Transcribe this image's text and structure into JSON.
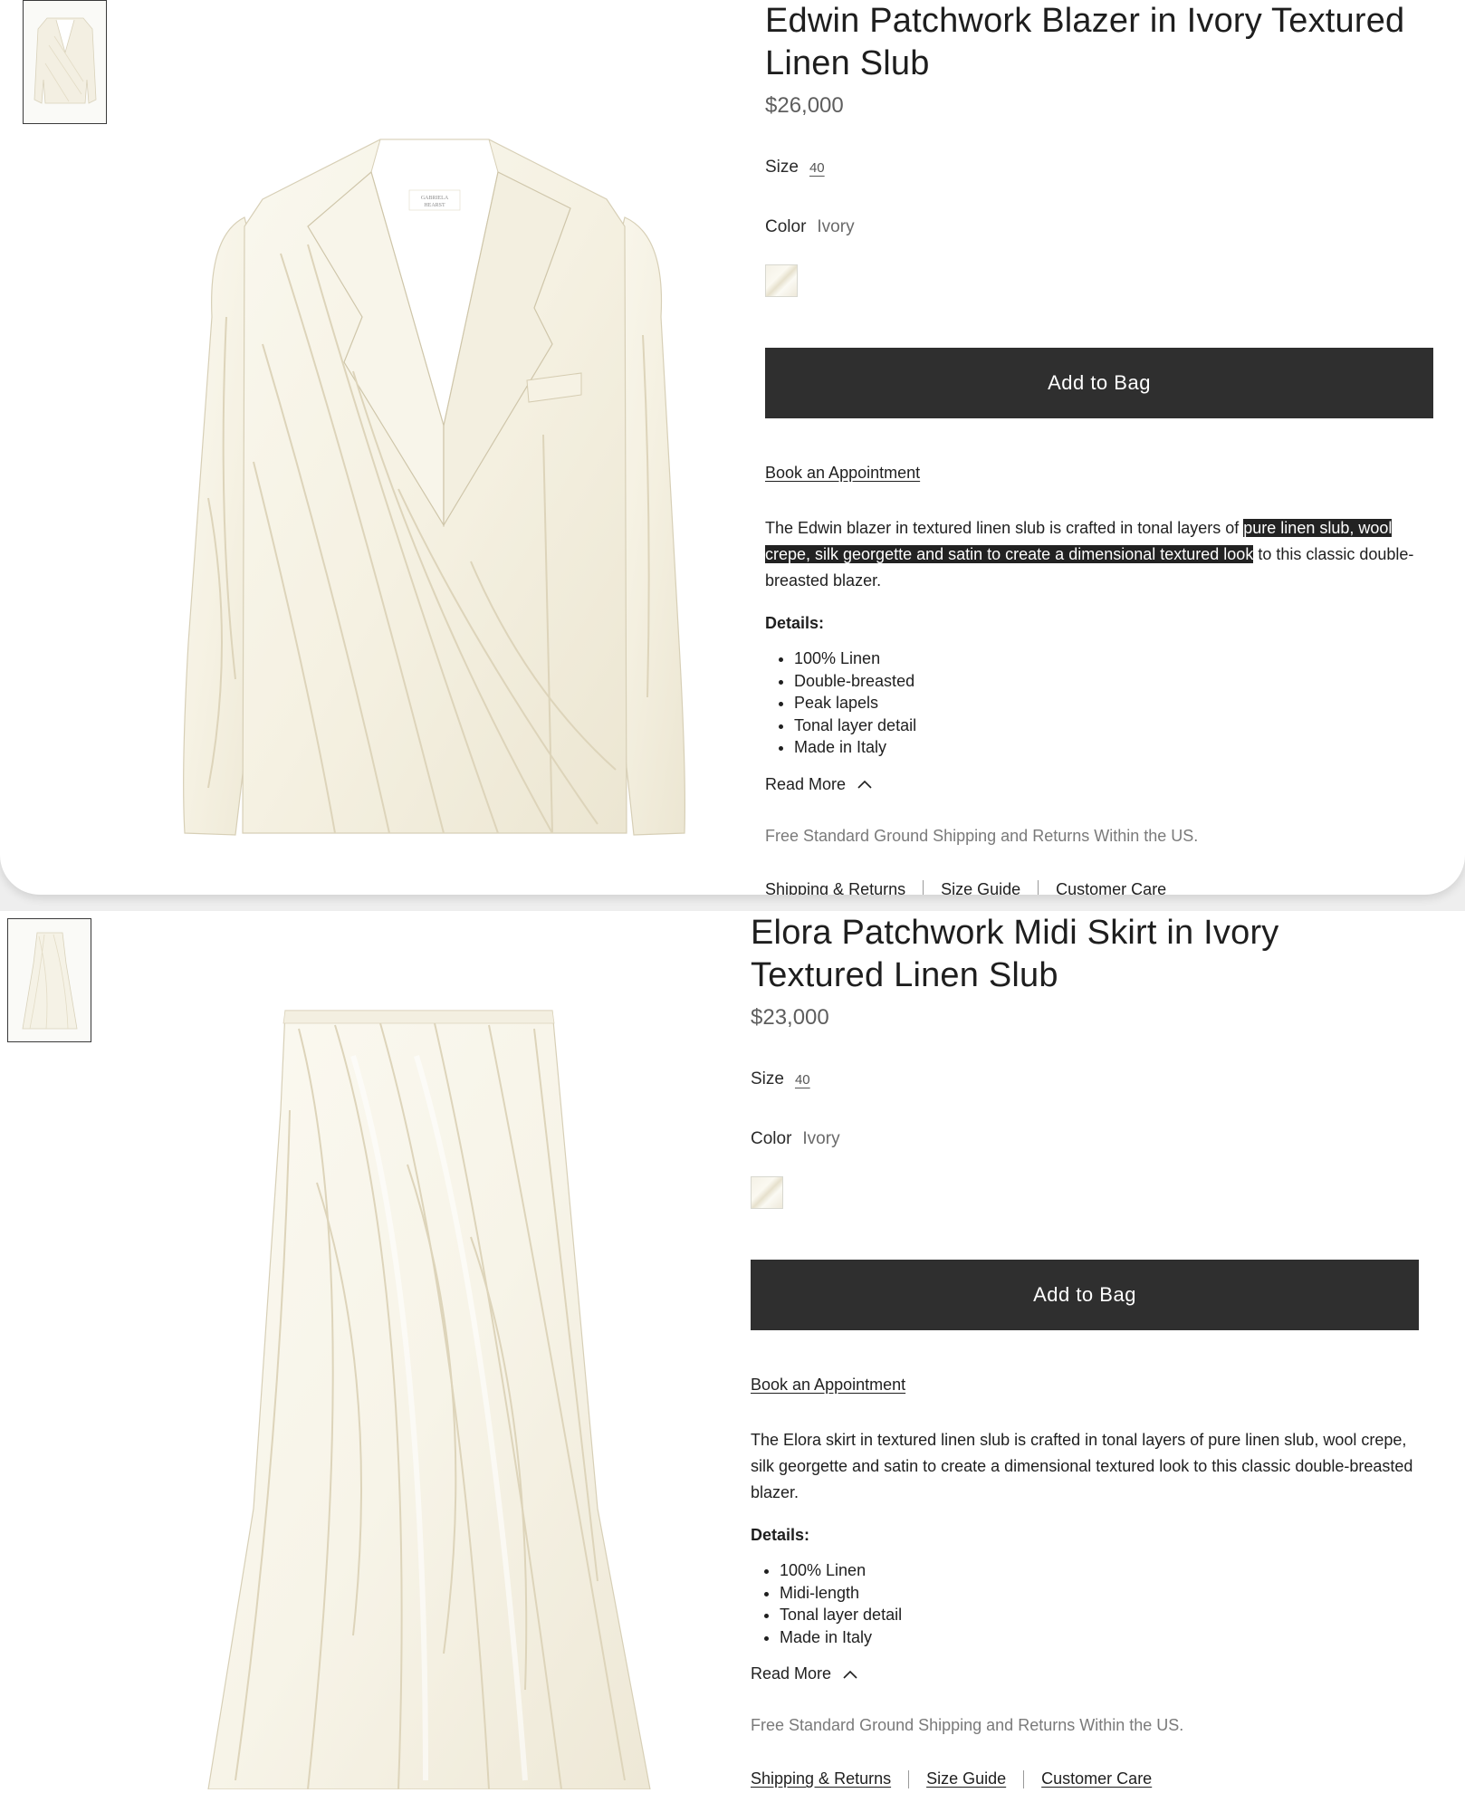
{
  "products": [
    {
      "title": "Edwin Patchwork Blazer in Ivory Textured Linen Slub",
      "price": "$26,000",
      "size_label": "Size",
      "size_value": "40",
      "color_label": "Color",
      "color_value": "Ivory",
      "add_to_bag": "Add to Bag",
      "book_appointment": "Book an Appointment",
      "description_before": "The Edwin blazer in textured linen slub is crafted in tonal layers of ",
      "description_highlight": "pure linen slub, wool crepe, silk georgette and satin to create a dimensional textured look",
      "description_after": " to this classic double-breasted blazer.",
      "details_heading": "Details:",
      "details": [
        "100% Linen",
        "Double-breasted",
        "Peak lapels",
        "Tonal layer detail",
        "Made in Italy"
      ],
      "read_more": "Read More",
      "shipping_note": "Free Standard Ground Shipping and Returns Within the US.",
      "links": [
        "Shipping & Returns",
        "Size Guide",
        "Customer Care"
      ],
      "brand_label_line1": "GABRIELA",
      "brand_label_line2": "HEARST"
    },
    {
      "title": "Elora Patchwork Midi Skirt in Ivory Textured Linen Slub",
      "price": "$23,000",
      "size_label": "Size",
      "size_value": "40",
      "color_label": "Color",
      "color_value": "Ivory",
      "add_to_bag": "Add to Bag",
      "book_appointment": "Book an Appointment",
      "description": "The Elora skirt in textured linen slub is crafted in tonal layers of pure linen slub, wool crepe, silk georgette and satin to create a dimensional textured look to this classic double-breasted blazer.",
      "details_heading": "Details:",
      "details": [
        "100% Linen",
        "Midi-length",
        "Tonal layer detail",
        "Made in Italy"
      ],
      "read_more": "Read More",
      "shipping_note": "Free Standard Ground Shipping and Returns Within the US.",
      "links": [
        "Shipping & Returns",
        "Size Guide",
        "Customer Care"
      ]
    }
  ],
  "icons": {
    "read_more_icon": "chevron-up-icon",
    "product_image_1": "blazer-image",
    "product_image_2": "skirt-image"
  },
  "colors": {
    "button_bg": "#2f2f2f",
    "highlight_bg": "#222222",
    "garment_ivory": "#f6f3e7"
  }
}
